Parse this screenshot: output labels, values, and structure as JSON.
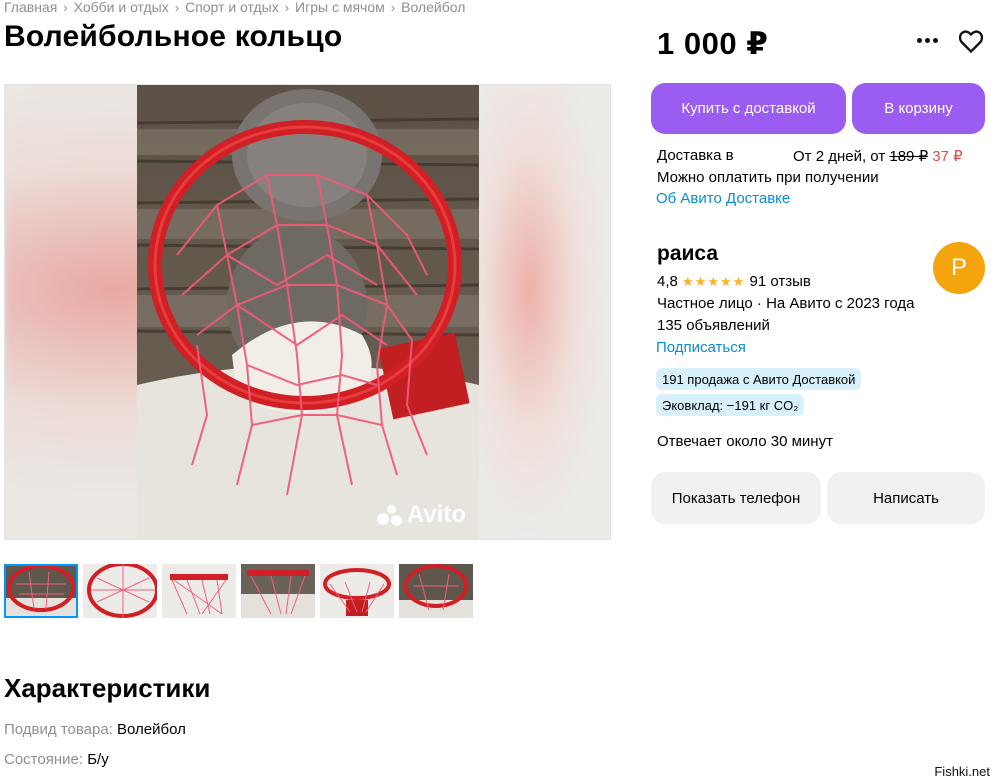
{
  "breadcrumb": [
    "Главная",
    "Хобби и отдых",
    "Спорт и отдых",
    "Игры с мячом",
    "Волейбол"
  ],
  "title": "Волейбольное кольцо",
  "gallery": {
    "watermark": "Avito",
    "thumbnail_count": 6,
    "selected_thumbnail": 1
  },
  "price": "1 000 ₽",
  "actions": {
    "buy_with_delivery": "Купить с доставкой",
    "add_to_cart": "В корзину"
  },
  "delivery": {
    "label": "Доставка в",
    "term": "От 2 дней, от",
    "old_price": "189 ₽",
    "new_price": "37 ₽",
    "payment_note": "Можно оплатить при получении",
    "about_link": "Об Авито Доставке"
  },
  "seller": {
    "name": "раиса",
    "avatar_letter": "Р",
    "rating": "4,8",
    "stars": "★★★★★",
    "reviews": "91 отзыв",
    "type": "Частное лицо · На Авито с 2023 года",
    "listings": "135 объявлений",
    "subscribe": "Подписаться",
    "badges": [
      "191 продажа с Авито Доставкой",
      "Эковклад: −191 кг CO₂"
    ],
    "response_time": "Отвечает около 30 минут",
    "show_phone": "Показать телефон",
    "write": "Написать"
  },
  "characteristics": {
    "title": "Характеристики",
    "items": [
      {
        "key": "Подвид товара:",
        "value": "Волейбол"
      },
      {
        "key": "Состояние:",
        "value": "Б/у"
      }
    ]
  },
  "credit": "Fishki.net",
  "colors": {
    "accent": "#9b5cf2",
    "link": "#0a8cd6",
    "avatar": "#f4a40c",
    "badge": "#d8f1fd",
    "sale_price": "#e04a4a"
  }
}
